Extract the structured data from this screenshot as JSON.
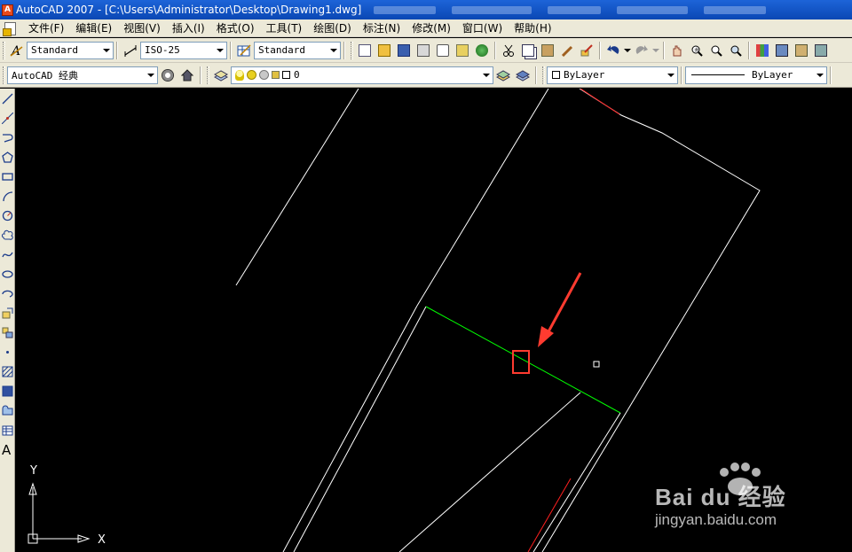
{
  "window": {
    "title": "AutoCAD 2007 - [C:\\Users\\Administrator\\Desktop\\Drawing1.dwg]",
    "app_badge": "A"
  },
  "menu": [
    {
      "label": "文件(F)"
    },
    {
      "label": "编辑(E)"
    },
    {
      "label": "视图(V)"
    },
    {
      "label": "插入(I)"
    },
    {
      "label": "格式(O)"
    },
    {
      "label": "工具(T)"
    },
    {
      "label": "绘图(D)"
    },
    {
      "label": "标注(N)"
    },
    {
      "label": "修改(M)"
    },
    {
      "label": "窗口(W)"
    },
    {
      "label": "帮助(H)"
    }
  ],
  "toolbar1": {
    "text_style": "Standard",
    "dim_style": "ISO-25",
    "table_style": "Standard"
  },
  "toolbar2": {
    "workspace": "AutoCAD 经典",
    "layer": "0",
    "color": "ByLayer",
    "linetype": "ByLayer"
  },
  "ucs": {
    "y_label": "Y",
    "x_label": "X"
  },
  "annotation": {
    "arrow_color": "#ff3b30",
    "box_color": "#ff3b30"
  },
  "colors": {
    "selected_line": "#00ff00",
    "red_line": "#ff2020",
    "canvas": "#000000"
  },
  "watermark": {
    "text": "Bai du 经验",
    "sub": "jingyan.baidu.com"
  }
}
